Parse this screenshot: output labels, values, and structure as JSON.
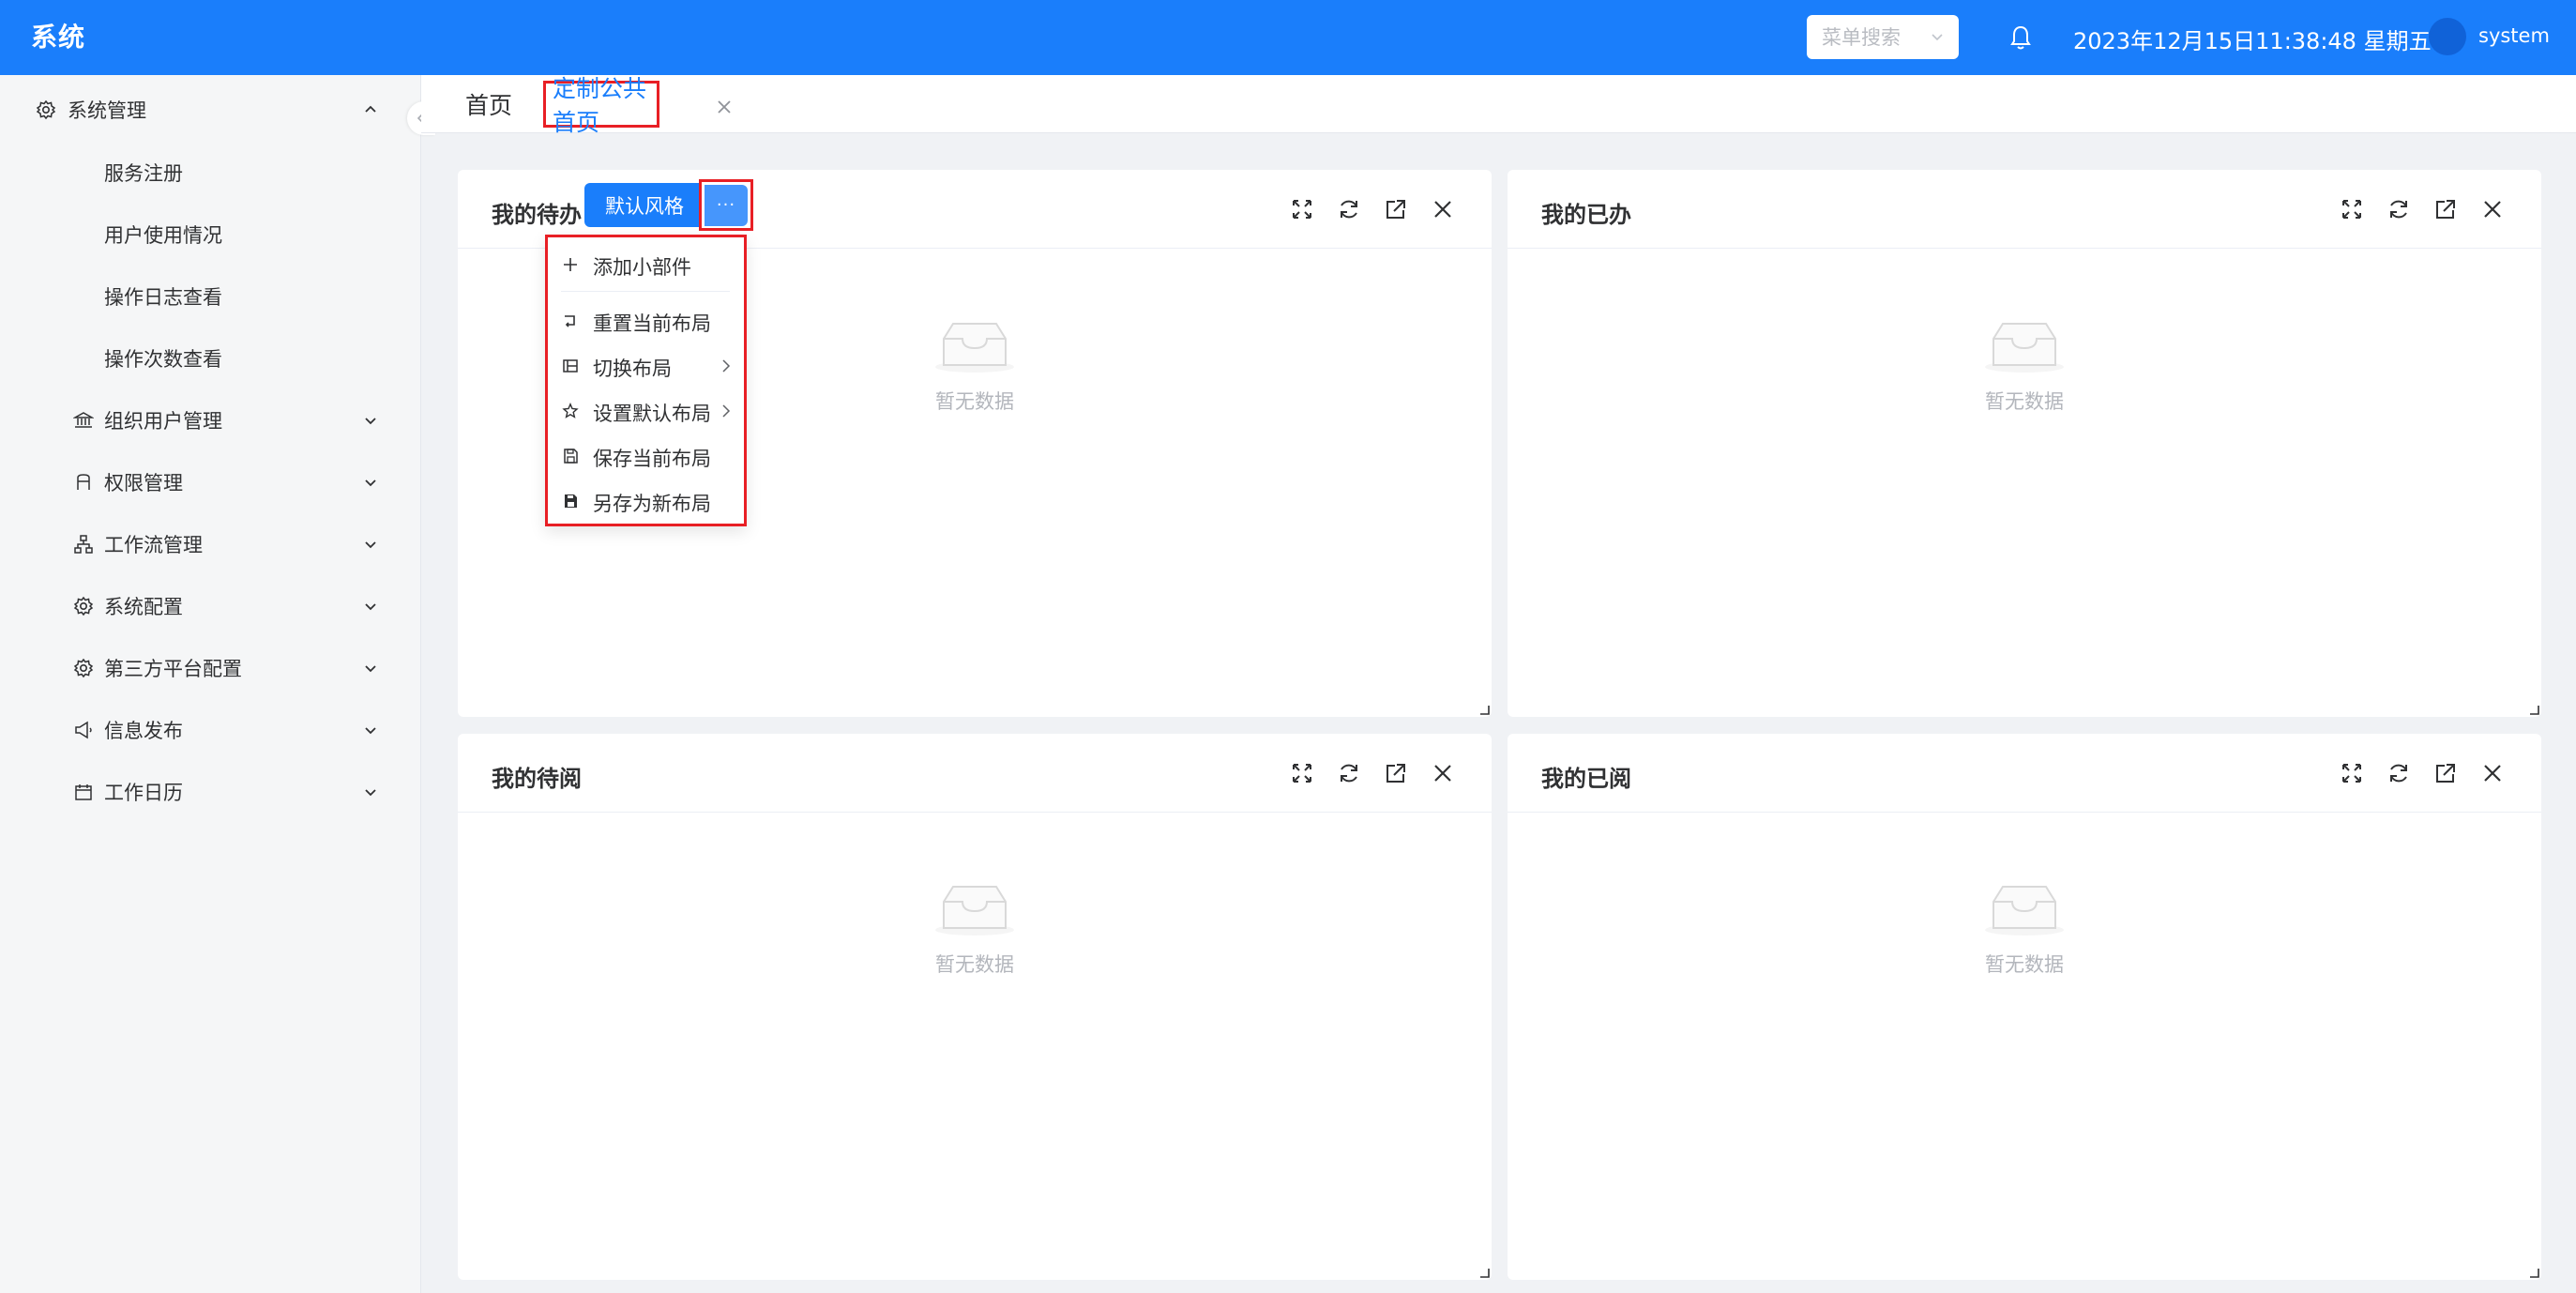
{
  "header": {
    "brand": "系统",
    "search_placeholder": "菜单搜索",
    "datetime": "2023年12月15日11:38:48 星期五",
    "username": "system",
    "icons": [
      "chevron-down-icon",
      "bell-icon"
    ]
  },
  "sidebar": {
    "items": [
      {
        "label": "系统管理",
        "icon": "gear-icon",
        "expanded": true
      },
      {
        "label": "服务注册"
      },
      {
        "label": "用户使用情况"
      },
      {
        "label": "操作日志查看"
      },
      {
        "label": "操作次数查看"
      },
      {
        "label": "组织用户管理",
        "icon": "bank-icon"
      },
      {
        "label": "权限管理",
        "icon": "user-lock-icon"
      },
      {
        "label": "工作流管理",
        "icon": "flow-icon"
      },
      {
        "label": "系统配置",
        "icon": "gear-icon"
      },
      {
        "label": "第三方平台配置",
        "icon": "gear-icon"
      },
      {
        "label": "信息发布",
        "icon": "megaphone-icon"
      },
      {
        "label": "工作日历",
        "icon": "calendar-icon"
      }
    ]
  },
  "tabs": [
    {
      "label": "首页"
    },
    {
      "label": "定制公共首页",
      "active": true
    }
  ],
  "widgets": [
    {
      "title": "我的待办",
      "empty_text": "暂无数据"
    },
    {
      "title": "我的已办",
      "empty_text": "暂无数据"
    },
    {
      "title": "我的待阅",
      "empty_text": "暂无数据"
    },
    {
      "title": "我的已阅",
      "empty_text": "暂无数据"
    }
  ],
  "widget_tools": [
    "fullscreen-icon",
    "refresh-icon",
    "open-external-icon",
    "close-icon"
  ],
  "style_button": "默认风格",
  "more_button": "···",
  "menu": {
    "items": [
      {
        "label": "添加小部件",
        "icon": "plus-icon"
      },
      {
        "label": "重置当前布局",
        "icon": "reset-icon"
      },
      {
        "label": "切换布局",
        "icon": "layout-icon",
        "submenu": true
      },
      {
        "label": "设置默认布局",
        "icon": "star-icon",
        "submenu": true
      },
      {
        "label": "保存当前布局",
        "icon": "save-icon"
      },
      {
        "label": "另存为新布局",
        "icon": "save-as-icon"
      }
    ]
  },
  "colors": {
    "primary": "#1a7efb",
    "highlight": "#e81f25",
    "background": "#f0f2f5"
  }
}
